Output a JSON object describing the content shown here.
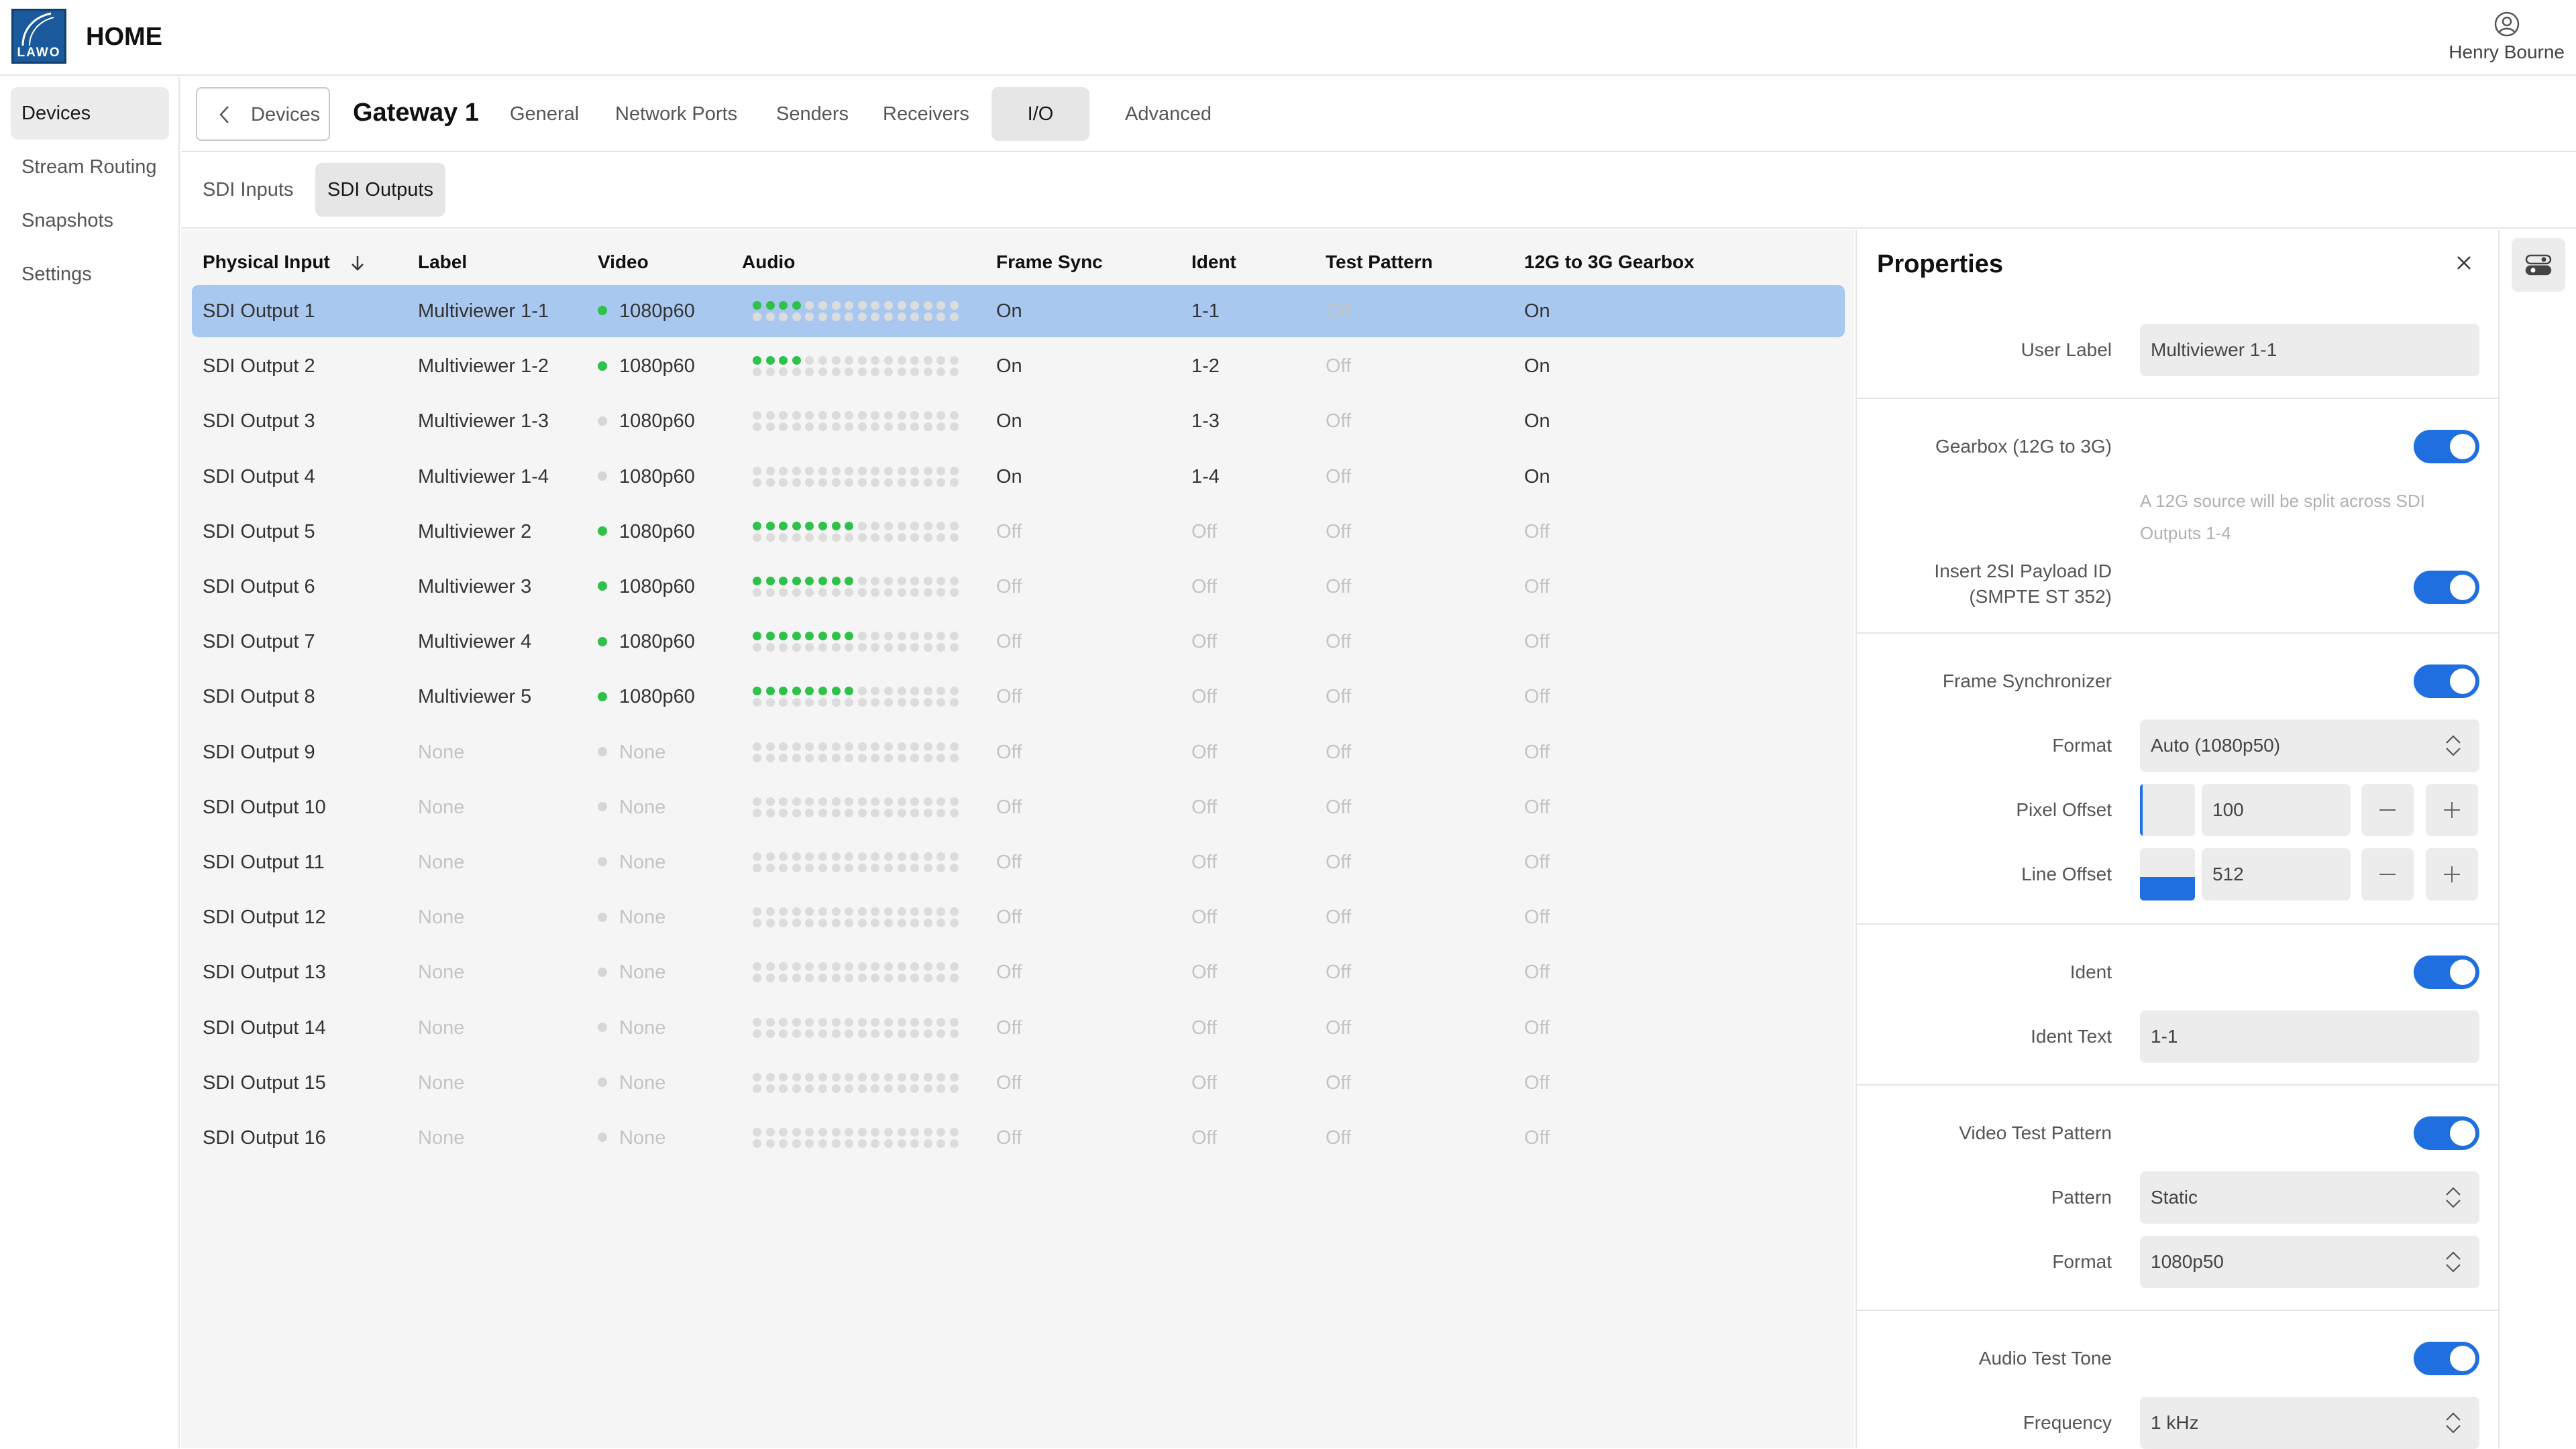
{
  "app": {
    "logo_text": "LAWO",
    "title": "HOME",
    "user_name": "Henry Bourne"
  },
  "sidebar": {
    "items": [
      {
        "label": "Devices",
        "active": true
      },
      {
        "label": "Stream Routing",
        "active": false
      },
      {
        "label": "Snapshots",
        "active": false
      },
      {
        "label": "Settings",
        "active": false
      }
    ]
  },
  "device": {
    "back_label": "Devices",
    "name": "Gateway 1",
    "tabs": [
      {
        "label": "General",
        "active": false
      },
      {
        "label": "Network Ports",
        "active": false
      },
      {
        "label": "Senders",
        "active": false
      },
      {
        "label": "Receivers",
        "active": false
      },
      {
        "label": "I/O",
        "active": true
      },
      {
        "label": "Advanced",
        "active": false
      }
    ]
  },
  "subtabs": [
    {
      "label": "SDI Inputs",
      "active": false
    },
    {
      "label": "SDI Outputs",
      "active": true
    }
  ],
  "table": {
    "columns": [
      "Physical Input",
      "Label",
      "Video",
      "Audio",
      "Frame Sync",
      "Ident",
      "Test Pattern",
      "12G to 3G Gearbox"
    ],
    "sort_indicator": "sort-descending-icon",
    "colors": {
      "signal_green": "#2ec24a",
      "signal_grey": "#d6d6d6",
      "selected_row": "#a8c8ef"
    },
    "rows": [
      {
        "name": "SDI Output 1",
        "label": "Multiviewer 1-1",
        "video": "1080p60",
        "video_ok": true,
        "audio_active": 4,
        "frame_sync": "On",
        "ident": "1-1",
        "test_pattern": "Off",
        "gearbox": "On",
        "selected": true
      },
      {
        "name": "SDI Output 2",
        "label": "Multiviewer 1-2",
        "video": "1080p60",
        "video_ok": true,
        "audio_active": 4,
        "frame_sync": "On",
        "ident": "1-2",
        "test_pattern": "Off",
        "gearbox": "On",
        "selected": false
      },
      {
        "name": "SDI Output 3",
        "label": "Multiviewer 1-3",
        "video": "1080p60",
        "video_ok": false,
        "audio_active": 0,
        "frame_sync": "On",
        "ident": "1-3",
        "test_pattern": "Off",
        "gearbox": "On",
        "selected": false
      },
      {
        "name": "SDI Output 4",
        "label": "Multiviewer 1-4",
        "video": "1080p60",
        "video_ok": false,
        "audio_active": 0,
        "frame_sync": "On",
        "ident": "1-4",
        "test_pattern": "Off",
        "gearbox": "On",
        "selected": false
      },
      {
        "name": "SDI Output 5",
        "label": "Multiviewer 2",
        "video": "1080p60",
        "video_ok": true,
        "audio_active": 8,
        "frame_sync": "Off",
        "ident": "Off",
        "test_pattern": "Off",
        "gearbox": "Off",
        "selected": false
      },
      {
        "name": "SDI Output 6",
        "label": "Multiviewer 3",
        "video": "1080p60",
        "video_ok": true,
        "audio_active": 8,
        "frame_sync": "Off",
        "ident": "Off",
        "test_pattern": "Off",
        "gearbox": "Off",
        "selected": false
      },
      {
        "name": "SDI Output 7",
        "label": "Multiviewer 4",
        "video": "1080p60",
        "video_ok": true,
        "audio_active": 8,
        "frame_sync": "Off",
        "ident": "Off",
        "test_pattern": "Off",
        "gearbox": "Off",
        "selected": false
      },
      {
        "name": "SDI Output 8",
        "label": "Multiviewer 5",
        "video": "1080p60",
        "video_ok": true,
        "audio_active": 8,
        "frame_sync": "Off",
        "ident": "Off",
        "test_pattern": "Off",
        "gearbox": "Off",
        "selected": false
      },
      {
        "name": "SDI Output 9",
        "label": "None",
        "video": "None",
        "video_ok": false,
        "audio_active": 0,
        "frame_sync": "Off",
        "ident": "Off",
        "test_pattern": "Off",
        "gearbox": "Off",
        "selected": false
      },
      {
        "name": "SDI Output 10",
        "label": "None",
        "video": "None",
        "video_ok": false,
        "audio_active": 0,
        "frame_sync": "Off",
        "ident": "Off",
        "test_pattern": "Off",
        "gearbox": "Off",
        "selected": false
      },
      {
        "name": "SDI Output 11",
        "label": "None",
        "video": "None",
        "video_ok": false,
        "audio_active": 0,
        "frame_sync": "Off",
        "ident": "Off",
        "test_pattern": "Off",
        "gearbox": "Off",
        "selected": false
      },
      {
        "name": "SDI Output 12",
        "label": "None",
        "video": "None",
        "video_ok": false,
        "audio_active": 0,
        "frame_sync": "Off",
        "ident": "Off",
        "test_pattern": "Off",
        "gearbox": "Off",
        "selected": false
      },
      {
        "name": "SDI Output 13",
        "label": "None",
        "video": "None",
        "video_ok": false,
        "audio_active": 0,
        "frame_sync": "Off",
        "ident": "Off",
        "test_pattern": "Off",
        "gearbox": "Off",
        "selected": false
      },
      {
        "name": "SDI Output 14",
        "label": "None",
        "video": "None",
        "video_ok": false,
        "audio_active": 0,
        "frame_sync": "Off",
        "ident": "Off",
        "test_pattern": "Off",
        "gearbox": "Off",
        "selected": false
      },
      {
        "name": "SDI Output 15",
        "label": "None",
        "video": "None",
        "video_ok": false,
        "audio_active": 0,
        "frame_sync": "Off",
        "ident": "Off",
        "test_pattern": "Off",
        "gearbox": "Off",
        "selected": false
      },
      {
        "name": "SDI Output 16",
        "label": "None",
        "video": "None",
        "video_ok": false,
        "audio_active": 0,
        "frame_sync": "Off",
        "ident": "Off",
        "test_pattern": "Off",
        "gearbox": "Off",
        "selected": false
      }
    ]
  },
  "properties": {
    "title": "Properties",
    "user_label": {
      "label": "User Label",
      "value": "Multiviewer 1-1"
    },
    "gearbox": {
      "label": "Gearbox (12G to 3G)",
      "on": true,
      "note": "A 12G source will be split across SDI Outputs 1-4"
    },
    "payload": {
      "label_line1": "Insert 2SI Payload ID",
      "label_line2": "(SMPTE ST 352)",
      "on": true
    },
    "frame_sync": {
      "label": "Frame Synchronizer",
      "on": true
    },
    "format": {
      "label": "Format",
      "value": "Auto (1080p50)"
    },
    "pixel_offset": {
      "label": "Pixel Offset",
      "value": "100",
      "level": 0.05
    },
    "line_offset": {
      "label": "Line Offset",
      "value": "512",
      "level": 0.45
    },
    "ident": {
      "label": "Ident",
      "on": true
    },
    "ident_text": {
      "label": "Ident Text",
      "value": "1-1"
    },
    "video_test": {
      "label": "Video Test Pattern",
      "on": true
    },
    "pattern": {
      "label": "Pattern",
      "value": "Static"
    },
    "test_format": {
      "label": "Format",
      "value": "1080p50"
    },
    "audio_tone": {
      "label": "Audio Test Tone",
      "on": true
    },
    "frequency": {
      "label": "Frequency",
      "value": "1 kHz"
    },
    "accent_color": "#1f6fe0"
  }
}
